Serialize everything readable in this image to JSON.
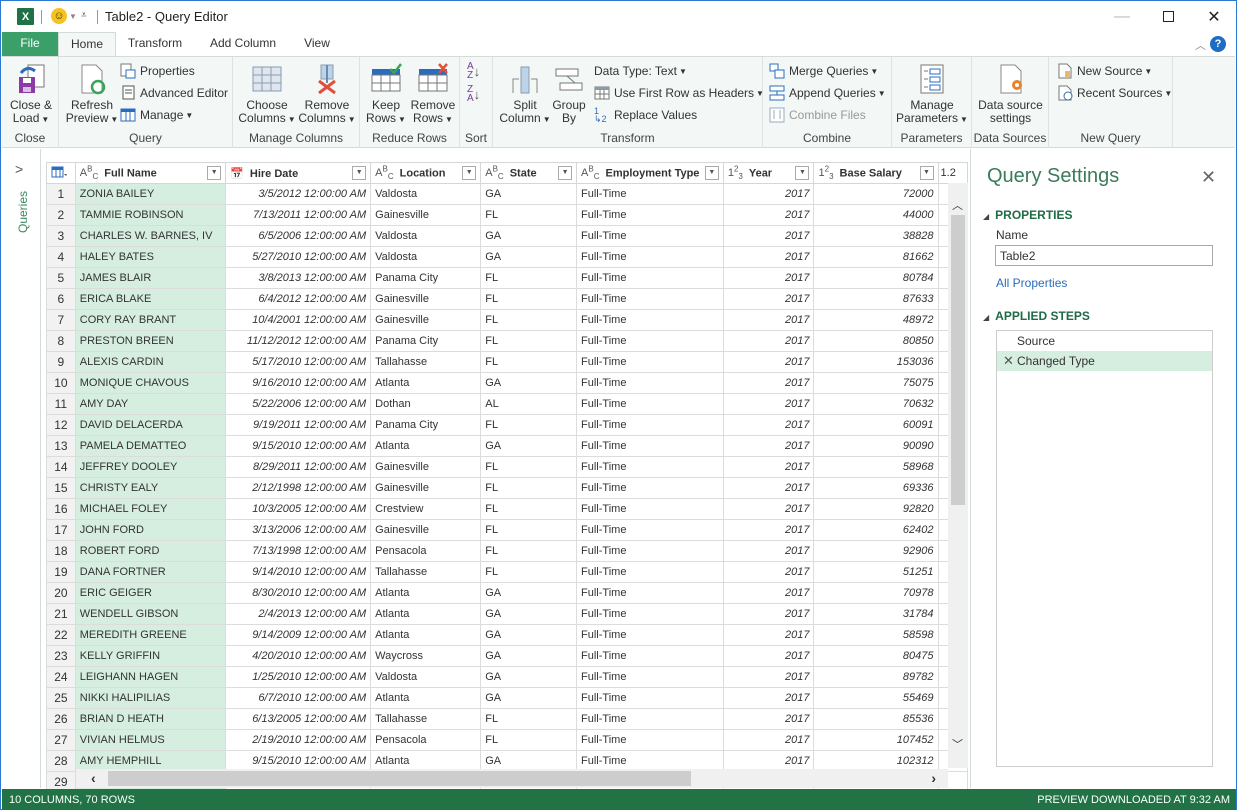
{
  "titlebar": {
    "title": "Table2 - Query Editor",
    "app_icon": "excel-icon",
    "smiley_icon": "smiley-feedback-icon",
    "qat_dropdown_icon": "customize-qat-icon",
    "minimize": "—",
    "close": "✕"
  },
  "ribbon_tabs": {
    "file": "File",
    "home": "Home",
    "transform": "Transform",
    "add_column": "Add Column",
    "view": "View",
    "active": "Home"
  },
  "ribbon": {
    "close_group": {
      "label": "Close",
      "close_load": [
        "Close &",
        "Load"
      ]
    },
    "query_group": {
      "label": "Query",
      "refresh_preview": [
        "Refresh",
        "Preview"
      ],
      "properties": "Properties",
      "advanced_editor": "Advanced Editor",
      "manage": "Manage"
    },
    "manage_columns_group": {
      "label": "Manage Columns",
      "choose_columns": [
        "Choose",
        "Columns"
      ],
      "remove_columns": [
        "Remove",
        "Columns"
      ]
    },
    "reduce_rows_group": {
      "label": "Reduce Rows",
      "keep_rows": [
        "Keep",
        "Rows"
      ],
      "remove_rows": [
        "Remove",
        "Rows"
      ]
    },
    "sort_group": {
      "label": "Sort",
      "sort_asc_icon": "sort-ascending-icon",
      "sort_desc_icon": "sort-descending-icon"
    },
    "transform_group": {
      "label": "Transform",
      "split_column": [
        "Split",
        "Column"
      ],
      "group_by": [
        "Group",
        "By"
      ],
      "data_type": "Data Type: Text",
      "use_first_row": "Use First Row as Headers",
      "replace_values": "Replace Values"
    },
    "combine_group": {
      "label": "Combine",
      "merge_queries": "Merge Queries",
      "append_queries": "Append Queries",
      "combine_files": "Combine Files"
    },
    "parameters_group": {
      "label": "Parameters",
      "manage_parameters": [
        "Manage",
        "Parameters"
      ]
    },
    "data_sources_group": {
      "label": "Data Sources",
      "data_source_settings": [
        "Data source",
        "settings"
      ]
    },
    "new_query_group": {
      "label": "New Query",
      "new_source": "New Source",
      "recent_sources": "Recent Sources"
    }
  },
  "queries_pane": {
    "label": "Queries"
  },
  "grid": {
    "columns": [
      {
        "type": "ABC",
        "name": "Full Name"
      },
      {
        "type": "datetime",
        "name": "Hire Date"
      },
      {
        "type": "ABC",
        "name": "Location"
      },
      {
        "type": "ABC",
        "name": "State"
      },
      {
        "type": "ABC",
        "name": "Employment Type"
      },
      {
        "type": "123",
        "name": "Year"
      },
      {
        "type": "123",
        "name": "Base Salary"
      },
      {
        "type": "1.2",
        "name": ""
      }
    ],
    "rows": [
      {
        "n": "1",
        "name": "ZONIA BAILEY",
        "date": "3/5/2012 12:00:00 AM",
        "loc": "Valdosta",
        "state": "GA",
        "emp": "Full-Time",
        "year": "2017",
        "salary": "72000"
      },
      {
        "n": "2",
        "name": "TAMMIE ROBINSON",
        "date": "7/13/2011 12:00:00 AM",
        "loc": "Gainesville",
        "state": "FL",
        "emp": "Full-Time",
        "year": "2017",
        "salary": "44000"
      },
      {
        "n": "3",
        "name": "CHARLES W. BARNES, IV",
        "date": "6/5/2006 12:00:00 AM",
        "loc": "Valdosta",
        "state": "GA",
        "emp": "Full-Time",
        "year": "2017",
        "salary": "38828"
      },
      {
        "n": "4",
        "name": "HALEY BATES",
        "date": "5/27/2010 12:00:00 AM",
        "loc": "Valdosta",
        "state": "GA",
        "emp": "Full-Time",
        "year": "2017",
        "salary": "81662"
      },
      {
        "n": "5",
        "name": "JAMES BLAIR",
        "date": "3/8/2013 12:00:00 AM",
        "loc": "Panama City",
        "state": "FL",
        "emp": "Full-Time",
        "year": "2017",
        "salary": "80784"
      },
      {
        "n": "6",
        "name": "ERICA BLAKE",
        "date": "6/4/2012 12:00:00 AM",
        "loc": "Gainesville",
        "state": "FL",
        "emp": "Full-Time",
        "year": "2017",
        "salary": "87633"
      },
      {
        "n": "7",
        "name": "CORY RAY BRANT",
        "date": "10/4/2001 12:00:00 AM",
        "loc": "Gainesville",
        "state": "FL",
        "emp": "Full-Time",
        "year": "2017",
        "salary": "48972"
      },
      {
        "n": "8",
        "name": "PRESTON BREEN",
        "date": "11/12/2012 12:00:00 AM",
        "loc": "Panama City",
        "state": "FL",
        "emp": "Full-Time",
        "year": "2017",
        "salary": "80850"
      },
      {
        "n": "9",
        "name": "ALEXIS CARDIN",
        "date": "5/17/2010 12:00:00 AM",
        "loc": "Tallahasse",
        "state": "FL",
        "emp": "Full-Time",
        "year": "2017",
        "salary": "153036"
      },
      {
        "n": "10",
        "name": "MONIQUE CHAVOUS",
        "date": "9/16/2010 12:00:00 AM",
        "loc": "Atlanta",
        "state": "GA",
        "emp": "Full-Time",
        "year": "2017",
        "salary": "75075"
      },
      {
        "n": "11",
        "name": "AMY DAY",
        "date": "5/22/2006 12:00:00 AM",
        "loc": "Dothan",
        "state": "AL",
        "emp": "Full-Time",
        "year": "2017",
        "salary": "70632"
      },
      {
        "n": "12",
        "name": "DAVID DELACERDA",
        "date": "9/19/2011 12:00:00 AM",
        "loc": "Panama City",
        "state": "FL",
        "emp": "Full-Time",
        "year": "2017",
        "salary": "60091"
      },
      {
        "n": "13",
        "name": "PAMELA DEMATTEO",
        "date": "9/15/2010 12:00:00 AM",
        "loc": "Atlanta",
        "state": "GA",
        "emp": "Full-Time",
        "year": "2017",
        "salary": "90090"
      },
      {
        "n": "14",
        "name": "JEFFREY DOOLEY",
        "date": "8/29/2011 12:00:00 AM",
        "loc": "Gainesville",
        "state": "FL",
        "emp": "Full-Time",
        "year": "2017",
        "salary": "58968"
      },
      {
        "n": "15",
        "name": "CHRISTY EALY",
        "date": "2/12/1998 12:00:00 AM",
        "loc": "Gainesville",
        "state": "FL",
        "emp": "Full-Time",
        "year": "2017",
        "salary": "69336"
      },
      {
        "n": "16",
        "name": "MICHAEL FOLEY",
        "date": "10/3/2005 12:00:00 AM",
        "loc": "Crestview",
        "state": "FL",
        "emp": "Full-Time",
        "year": "2017",
        "salary": "92820"
      },
      {
        "n": "17",
        "name": "JOHN FORD",
        "date": "3/13/2006 12:00:00 AM",
        "loc": "Gainesville",
        "state": "FL",
        "emp": "Full-Time",
        "year": "2017",
        "salary": "62402"
      },
      {
        "n": "18",
        "name": "ROBERT FORD",
        "date": "7/13/1998 12:00:00 AM",
        "loc": "Pensacola",
        "state": "FL",
        "emp": "Full-Time",
        "year": "2017",
        "salary": "92906"
      },
      {
        "n": "19",
        "name": "DANA FORTNER",
        "date": "9/14/2010 12:00:00 AM",
        "loc": "Tallahasse",
        "state": "FL",
        "emp": "Full-Time",
        "year": "2017",
        "salary": "51251"
      },
      {
        "n": "20",
        "name": "ERIC GEIGER",
        "date": "8/30/2010 12:00:00 AM",
        "loc": "Atlanta",
        "state": "GA",
        "emp": "Full-Time",
        "year": "2017",
        "salary": "70978"
      },
      {
        "n": "21",
        "name": "WENDELL GIBSON",
        "date": "2/4/2013 12:00:00 AM",
        "loc": "Atlanta",
        "state": "GA",
        "emp": "Full-Time",
        "year": "2017",
        "salary": "31784"
      },
      {
        "n": "22",
        "name": "MEREDITH GREENE",
        "date": "9/14/2009 12:00:00 AM",
        "loc": "Atlanta",
        "state": "GA",
        "emp": "Full-Time",
        "year": "2017",
        "salary": "58598"
      },
      {
        "n": "23",
        "name": "KELLY GRIFFIN",
        "date": "4/20/2010 12:00:00 AM",
        "loc": "Waycross",
        "state": "GA",
        "emp": "Full-Time",
        "year": "2017",
        "salary": "80475"
      },
      {
        "n": "24",
        "name": "LEIGHANN HAGEN",
        "date": "1/25/2010 12:00:00 AM",
        "loc": "Valdosta",
        "state": "GA",
        "emp": "Full-Time",
        "year": "2017",
        "salary": "89782"
      },
      {
        "n": "25",
        "name": "NIKKI HALIPILIAS",
        "date": "6/7/2010 12:00:00 AM",
        "loc": "Atlanta",
        "state": "GA",
        "emp": "Full-Time",
        "year": "2017",
        "salary": "55469"
      },
      {
        "n": "26",
        "name": "BRIAN D HEATH",
        "date": "6/13/2005 12:00:00 AM",
        "loc": "Tallahasse",
        "state": "FL",
        "emp": "Full-Time",
        "year": "2017",
        "salary": "85536"
      },
      {
        "n": "27",
        "name": "VIVIAN HELMUS",
        "date": "2/19/2010 12:00:00 AM",
        "loc": "Pensacola",
        "state": "FL",
        "emp": "Full-Time",
        "year": "2017",
        "salary": "107452"
      },
      {
        "n": "28",
        "name": "AMY HEMPHILL",
        "date": "9/15/2010 12:00:00 AM",
        "loc": "Atlanta",
        "state": "GA",
        "emp": "Full-Time",
        "year": "2017",
        "salary": "102312"
      },
      {
        "n": "29",
        "name": "",
        "date": "",
        "loc": "",
        "state": "",
        "emp": "",
        "year": "",
        "salary": ""
      }
    ]
  },
  "query_settings": {
    "title": "Query Settings",
    "close": "✕",
    "properties_header": "PROPERTIES",
    "name_label": "Name",
    "name_value": "Table2",
    "all_properties": "All Properties",
    "applied_steps_header": "APPLIED STEPS",
    "steps": [
      {
        "label": "Source",
        "selected": false
      },
      {
        "label": "Changed Type",
        "selected": true
      }
    ]
  },
  "statusbar": {
    "left": "10 COLUMNS, 70 ROWS",
    "right": "PREVIEW DOWNLOADED AT 9:32 AM"
  },
  "colors": {
    "accent_green": "#217346",
    "file_tab": "#3b9f6a",
    "selected_column": "#d6eee0",
    "title_accent": "#3b7b5c",
    "link_blue": "#2a6cbf"
  }
}
